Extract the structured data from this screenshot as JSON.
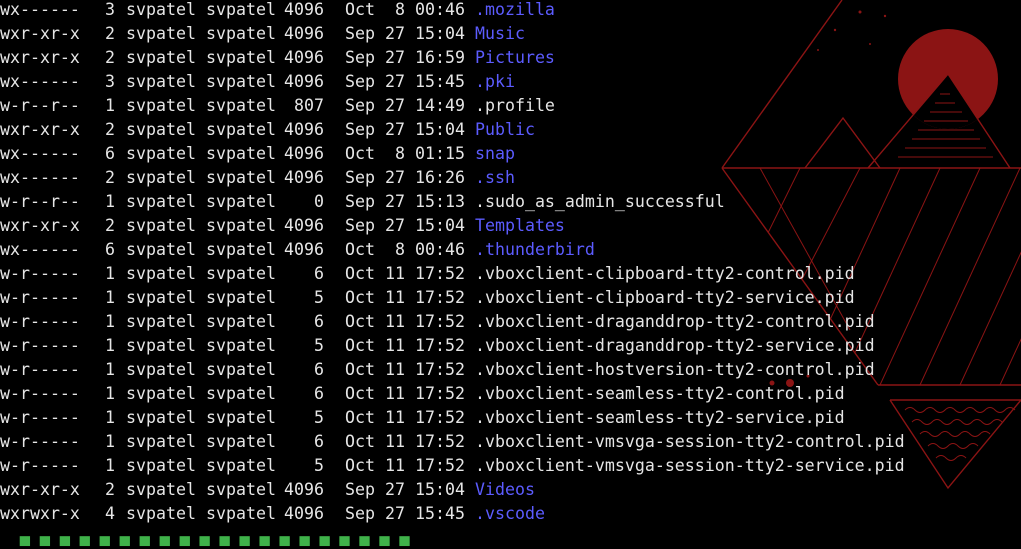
{
  "theme": {
    "background": "#000000",
    "text_color": "#e6e6e6",
    "directory_color": "#5c5cff",
    "prompt_color": "#3fb24a",
    "wallpaper_accent": "#8b1414"
  },
  "listing": [
    {
      "perm": "rwx------",
      "links": "3",
      "owner": "svpatel",
      "group": "svpatel",
      "size": "4096",
      "month": "Oct",
      "day": "8",
      "time": "00:46",
      "name": ".mozilla",
      "type": "dir"
    },
    {
      "perm": "rwxr-xr-x",
      "links": "2",
      "owner": "svpatel",
      "group": "svpatel",
      "size": "4096",
      "month": "Sep",
      "day": "27",
      "time": "15:04",
      "name": "Music",
      "type": "dir"
    },
    {
      "perm": "rwxr-xr-x",
      "links": "2",
      "owner": "svpatel",
      "group": "svpatel",
      "size": "4096",
      "month": "Sep",
      "day": "27",
      "time": "16:59",
      "name": "Pictures",
      "type": "dir"
    },
    {
      "perm": "rwx------",
      "links": "3",
      "owner": "svpatel",
      "group": "svpatel",
      "size": "4096",
      "month": "Sep",
      "day": "27",
      "time": "15:45",
      "name": ".pki",
      "type": "dir"
    },
    {
      "perm": "rw-r--r--",
      "links": "1",
      "owner": "svpatel",
      "group": "svpatel",
      "size": "807",
      "month": "Sep",
      "day": "27",
      "time": "14:49",
      "name": ".profile",
      "type": "file"
    },
    {
      "perm": "rwxr-xr-x",
      "links": "2",
      "owner": "svpatel",
      "group": "svpatel",
      "size": "4096",
      "month": "Sep",
      "day": "27",
      "time": "15:04",
      "name": "Public",
      "type": "dir"
    },
    {
      "perm": "rwx------",
      "links": "6",
      "owner": "svpatel",
      "group": "svpatel",
      "size": "4096",
      "month": "Oct",
      "day": "8",
      "time": "01:15",
      "name": "snap",
      "type": "dir"
    },
    {
      "perm": "rwx------",
      "links": "2",
      "owner": "svpatel",
      "group": "svpatel",
      "size": "4096",
      "month": "Sep",
      "day": "27",
      "time": "16:26",
      "name": ".ssh",
      "type": "dir"
    },
    {
      "perm": "rw-r--r--",
      "links": "1",
      "owner": "svpatel",
      "group": "svpatel",
      "size": "0",
      "month": "Sep",
      "day": "27",
      "time": "15:13",
      "name": ".sudo_as_admin_successful",
      "type": "file"
    },
    {
      "perm": "rwxr-xr-x",
      "links": "2",
      "owner": "svpatel",
      "group": "svpatel",
      "size": "4096",
      "month": "Sep",
      "day": "27",
      "time": "15:04",
      "name": "Templates",
      "type": "dir"
    },
    {
      "perm": "rwx------",
      "links": "6",
      "owner": "svpatel",
      "group": "svpatel",
      "size": "4096",
      "month": "Oct",
      "day": "8",
      "time": "00:46",
      "name": ".thunderbird",
      "type": "dir"
    },
    {
      "perm": "rw-r-----",
      "links": "1",
      "owner": "svpatel",
      "group": "svpatel",
      "size": "6",
      "month": "Oct",
      "day": "11",
      "time": "17:52",
      "name": ".vboxclient-clipboard-tty2-control.pid",
      "type": "file"
    },
    {
      "perm": "rw-r-----",
      "links": "1",
      "owner": "svpatel",
      "group": "svpatel",
      "size": "5",
      "month": "Oct",
      "day": "11",
      "time": "17:52",
      "name": ".vboxclient-clipboard-tty2-service.pid",
      "type": "file"
    },
    {
      "perm": "rw-r-----",
      "links": "1",
      "owner": "svpatel",
      "group": "svpatel",
      "size": "6",
      "month": "Oct",
      "day": "11",
      "time": "17:52",
      "name": ".vboxclient-draganddrop-tty2-control.pid",
      "type": "file"
    },
    {
      "perm": "rw-r-----",
      "links": "1",
      "owner": "svpatel",
      "group": "svpatel",
      "size": "5",
      "month": "Oct",
      "day": "11",
      "time": "17:52",
      "name": ".vboxclient-draganddrop-tty2-service.pid",
      "type": "file"
    },
    {
      "perm": "rw-r-----",
      "links": "1",
      "owner": "svpatel",
      "group": "svpatel",
      "size": "6",
      "month": "Oct",
      "day": "11",
      "time": "17:52",
      "name": ".vboxclient-hostversion-tty2-control.pid",
      "type": "file"
    },
    {
      "perm": "rw-r-----",
      "links": "1",
      "owner": "svpatel",
      "group": "svpatel",
      "size": "6",
      "month": "Oct",
      "day": "11",
      "time": "17:52",
      "name": ".vboxclient-seamless-tty2-control.pid",
      "type": "file"
    },
    {
      "perm": "rw-r-----",
      "links": "1",
      "owner": "svpatel",
      "group": "svpatel",
      "size": "5",
      "month": "Oct",
      "day": "11",
      "time": "17:52",
      "name": ".vboxclient-seamless-tty2-service.pid",
      "type": "file"
    },
    {
      "perm": "rw-r-----",
      "links": "1",
      "owner": "svpatel",
      "group": "svpatel",
      "size": "6",
      "month": "Oct",
      "day": "11",
      "time": "17:52",
      "name": ".vboxclient-vmsvga-session-tty2-control.pid",
      "type": "file"
    },
    {
      "perm": "rw-r-----",
      "links": "1",
      "owner": "svpatel",
      "group": "svpatel",
      "size": "5",
      "month": "Oct",
      "day": "11",
      "time": "17:52",
      "name": ".vboxclient-vmsvga-session-tty2-service.pid",
      "type": "file"
    },
    {
      "perm": "rwxr-xr-x",
      "links": "2",
      "owner": "svpatel",
      "group": "svpatel",
      "size": "4096",
      "month": "Sep",
      "day": "27",
      "time": "15:04",
      "name": "Videos",
      "type": "dir"
    },
    {
      "perm": "rwxrwxr-x",
      "links": "4",
      "owner": "svpatel",
      "group": "svpatel",
      "size": "4096",
      "month": "Sep",
      "day": "27",
      "time": "15:45",
      "name": ".vscode",
      "type": "dir"
    }
  ]
}
